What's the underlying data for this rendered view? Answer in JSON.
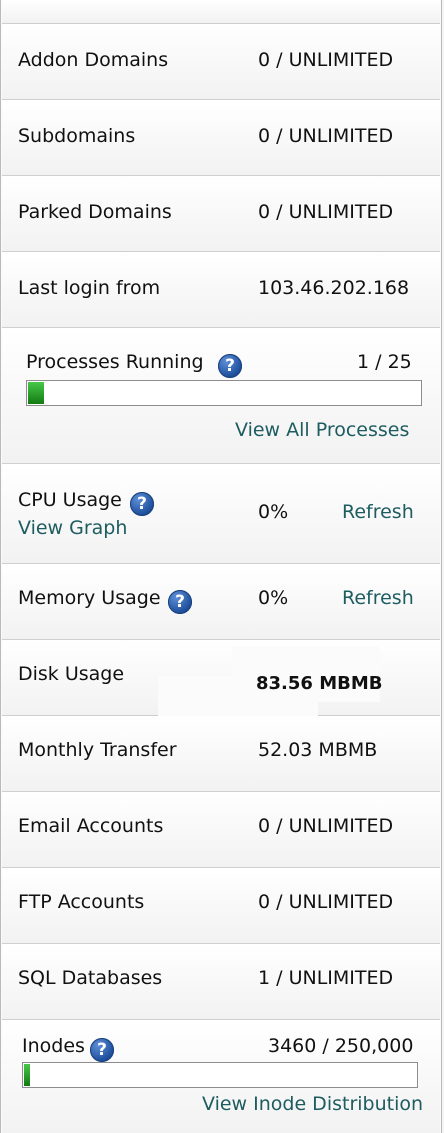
{
  "stats": {
    "addon_domains": {
      "label": "Addon Domains",
      "value": "0 / UNLIMITED"
    },
    "subdomains": {
      "label": "Subdomains",
      "value": "0 / UNLIMITED"
    },
    "parked_domains": {
      "label": "Parked Domains",
      "value": "0 / UNLIMITED"
    },
    "last_login": {
      "label": "Last login from",
      "value": "103.46.202.168"
    },
    "processes": {
      "label": "Processes Running",
      "value": "1 / 25",
      "link": "View All Processes",
      "fill_percent": 4
    },
    "cpu": {
      "label": "CPU Usage",
      "value": "0%",
      "refresh": "Refresh",
      "graph": "View Graph"
    },
    "memory": {
      "label": "Memory Usage",
      "value": "0%",
      "refresh": "Refresh"
    },
    "disk": {
      "label": "Disk Usage",
      "value": "83.56 MBMB"
    },
    "monthly_transfer": {
      "label": "Monthly Transfer",
      "value": "52.03 MBMB"
    },
    "email_accounts": {
      "label": "Email Accounts",
      "value": "0 / UNLIMITED"
    },
    "ftp_accounts": {
      "label": "FTP Accounts",
      "value": "0 / UNLIMITED"
    },
    "sql_databases": {
      "label": "SQL Databases",
      "value": "1 / UNLIMITED"
    },
    "inodes": {
      "label": "Inodes",
      "value": "3460 / 250,000",
      "link": "View Inode Distribution",
      "fill_percent": 1.4
    }
  },
  "icons": {
    "help": "question-mark-help-icon"
  },
  "colors": {
    "link": "#1d5c5f",
    "bar_fill": "#27a427",
    "help_icon": "#2a5db0"
  }
}
